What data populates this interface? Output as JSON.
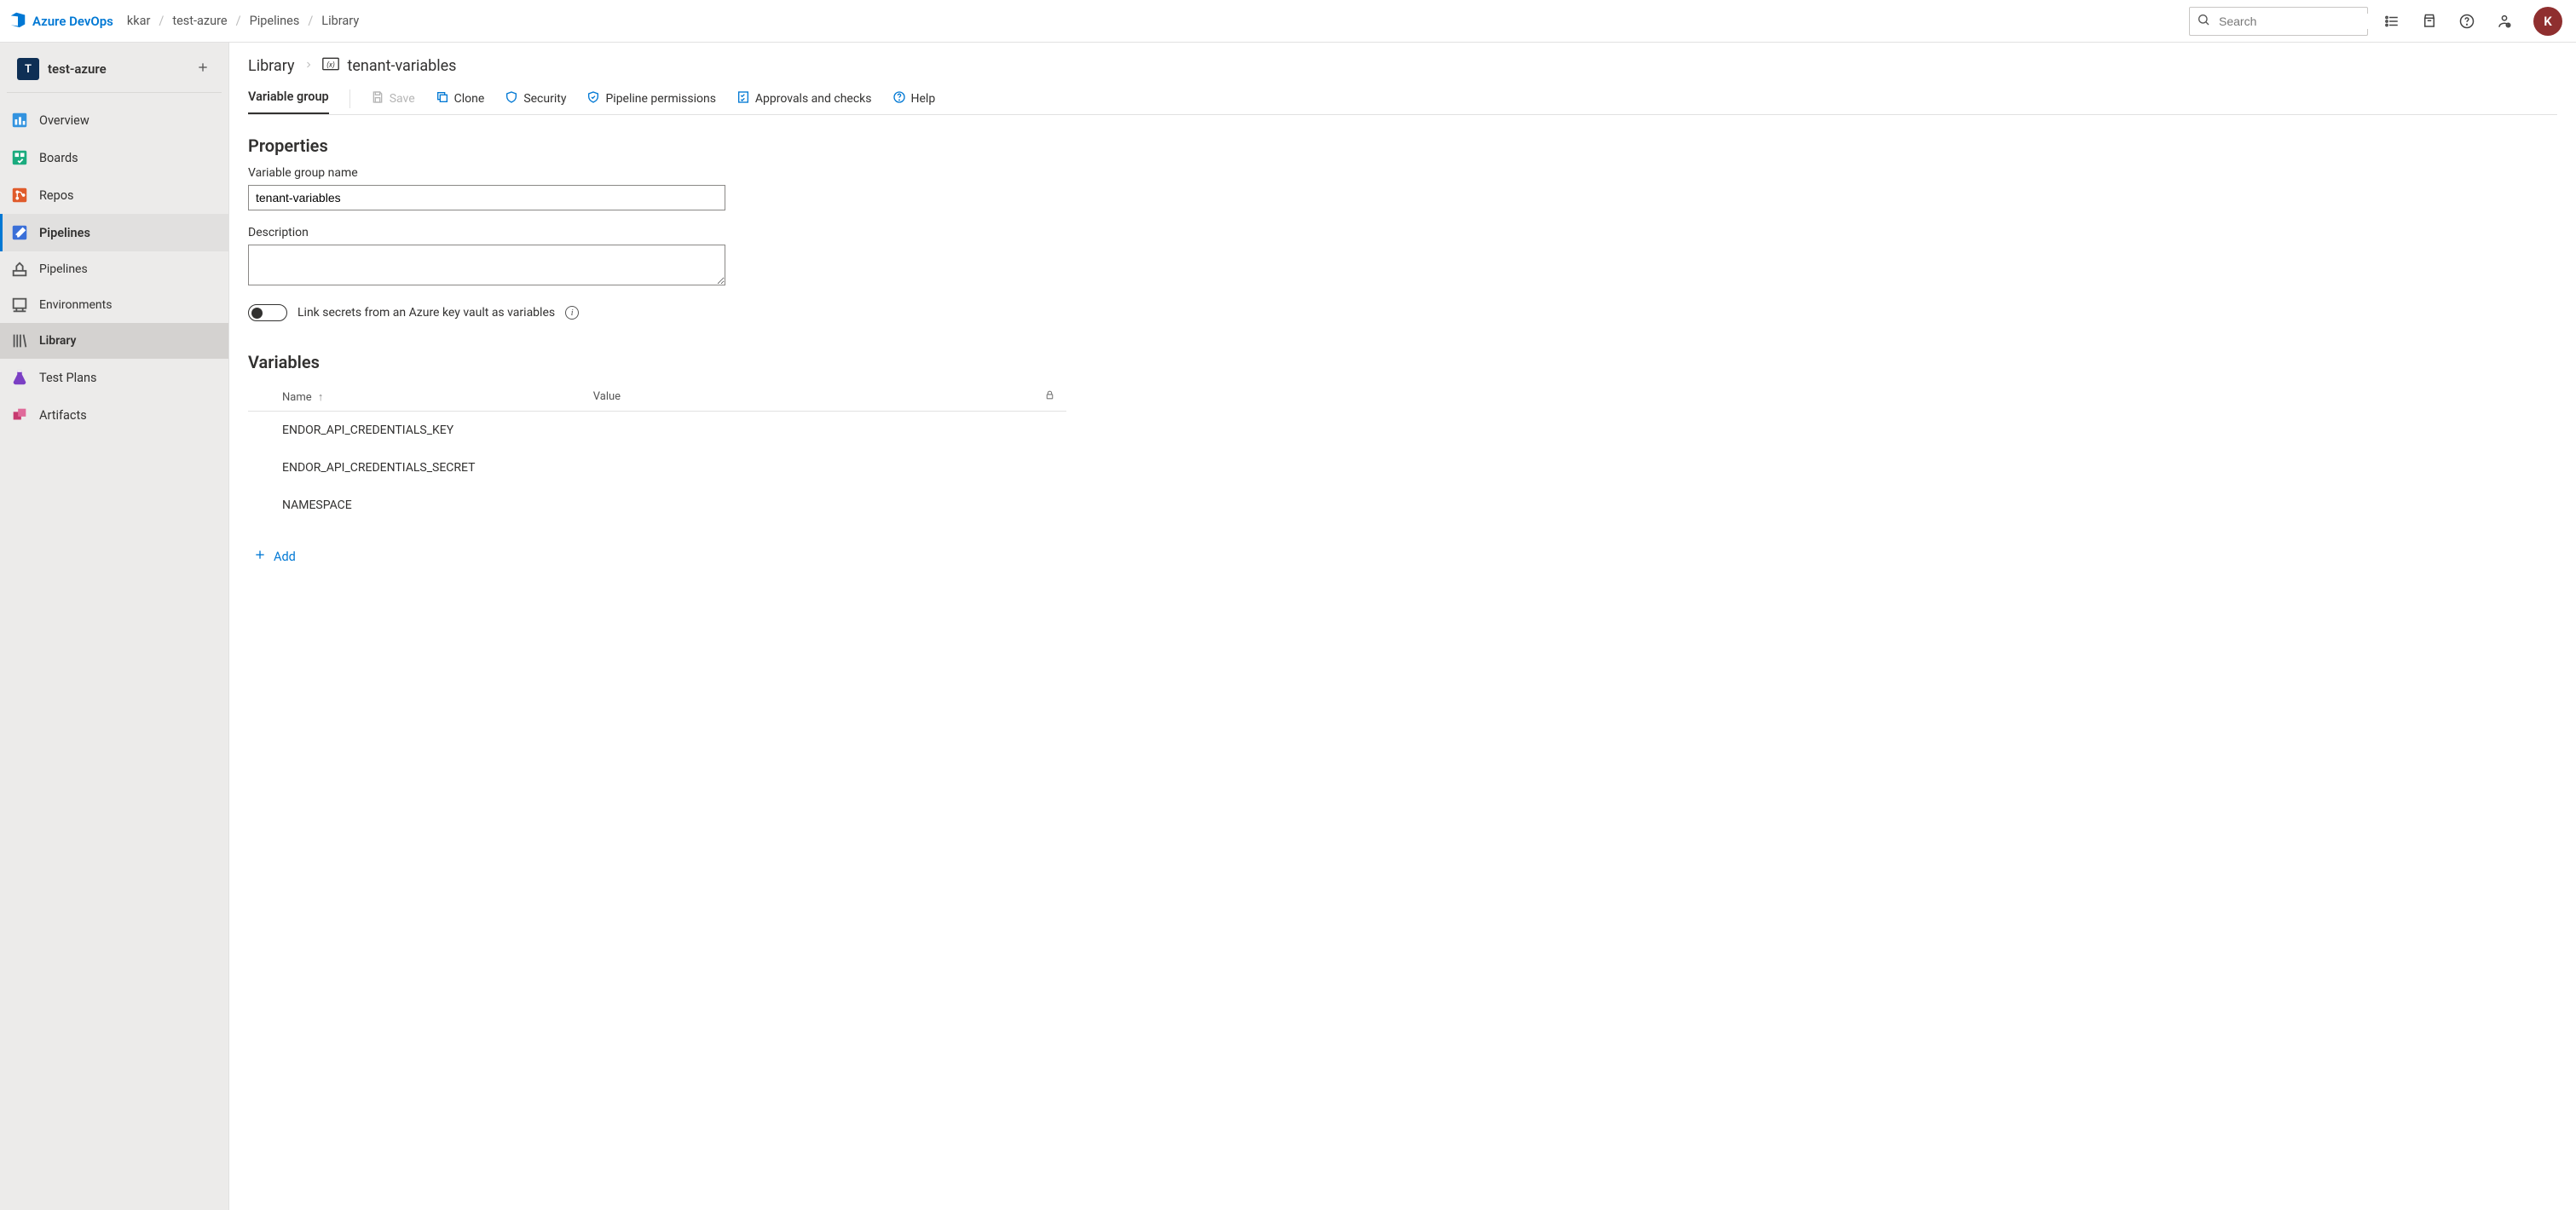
{
  "brand": {
    "name": "Azure DevOps"
  },
  "top_breadcrumbs": [
    "kkar",
    "test-azure",
    "Pipelines",
    "Library"
  ],
  "search": {
    "placeholder": "Search"
  },
  "avatar": {
    "initial": "K",
    "bg": "#8f2f2f"
  },
  "project": {
    "initial": "T",
    "name": "test-azure"
  },
  "sidebar": {
    "items": [
      {
        "k": "overview",
        "label": "Overview"
      },
      {
        "k": "boards",
        "label": "Boards"
      },
      {
        "k": "repos",
        "label": "Repos"
      },
      {
        "k": "pipelines",
        "label": "Pipelines"
      },
      {
        "k": "test-plans",
        "label": "Test Plans"
      },
      {
        "k": "artifacts",
        "label": "Artifacts"
      }
    ],
    "pipelines_sub": [
      {
        "k": "pipelines-sub",
        "label": "Pipelines"
      },
      {
        "k": "environments",
        "label": "Environments"
      },
      {
        "k": "library",
        "label": "Library"
      }
    ]
  },
  "page": {
    "parent": "Library",
    "current": "tenant-variables"
  },
  "toolbar": {
    "tab": "Variable group",
    "save": "Save",
    "clone": "Clone",
    "security": "Security",
    "perms": "Pipeline permissions",
    "checks": "Approvals and checks",
    "help": "Help"
  },
  "properties": {
    "section_title": "Properties",
    "name_label": "Variable group name",
    "name_value": "tenant-variables",
    "desc_label": "Description",
    "desc_value": "",
    "kv_toggle_label": "Link secrets from an Azure key vault as variables",
    "kv_toggle_on": false
  },
  "variables": {
    "section_title": "Variables",
    "headers": {
      "name": "Name",
      "value": "Value"
    },
    "rows": [
      {
        "name": "ENDOR_API_CREDENTIALS_KEY",
        "value": ""
      },
      {
        "name": "ENDOR_API_CREDENTIALS_SECRET",
        "value": ""
      },
      {
        "name": "NAMESPACE",
        "value": ""
      }
    ],
    "add_label": "Add"
  }
}
